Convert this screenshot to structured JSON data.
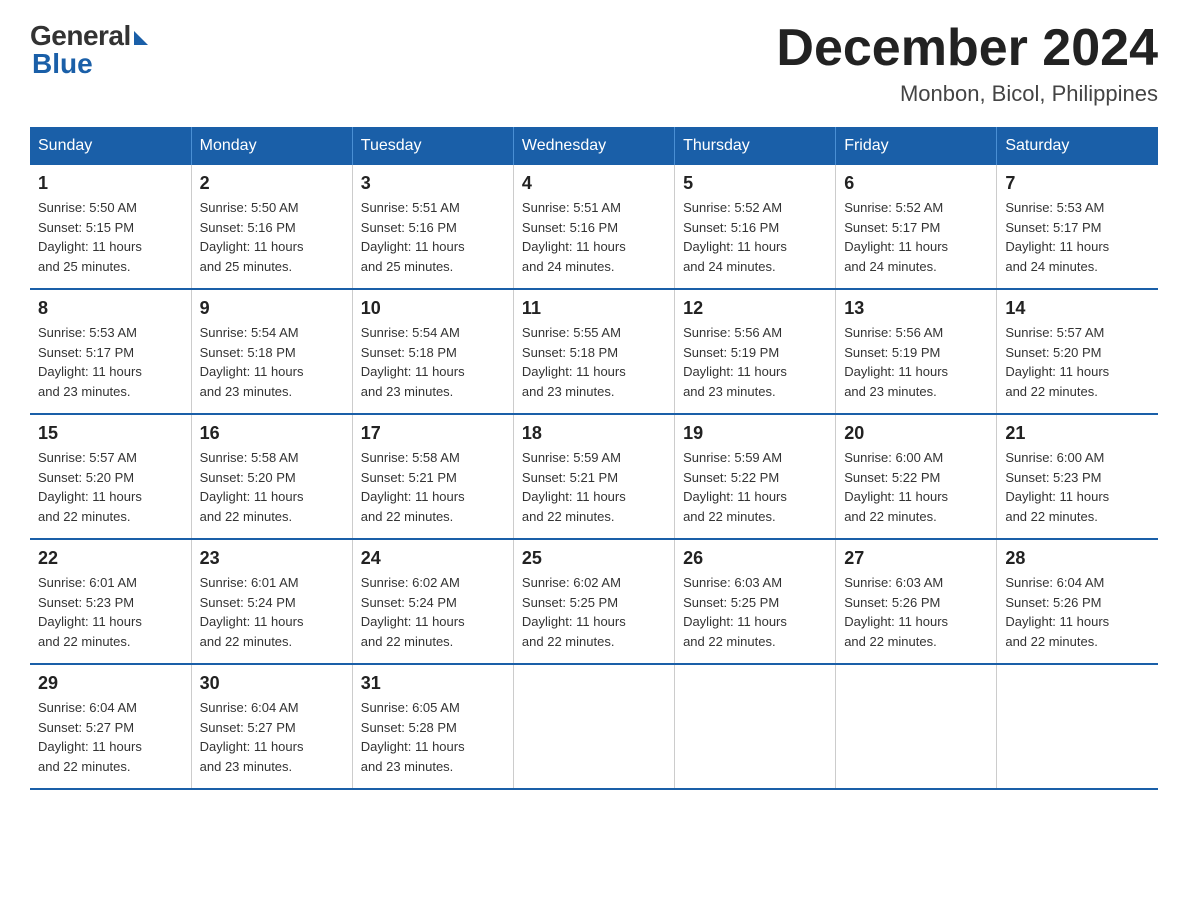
{
  "logo": {
    "general": "General",
    "blue": "Blue"
  },
  "title": {
    "month_year": "December 2024",
    "location": "Monbon, Bicol, Philippines"
  },
  "headers": [
    "Sunday",
    "Monday",
    "Tuesday",
    "Wednesday",
    "Thursday",
    "Friday",
    "Saturday"
  ],
  "weeks": [
    [
      {
        "day": "1",
        "sunrise": "5:50 AM",
        "sunset": "5:15 PM",
        "daylight": "11 hours and 25 minutes."
      },
      {
        "day": "2",
        "sunrise": "5:50 AM",
        "sunset": "5:16 PM",
        "daylight": "11 hours and 25 minutes."
      },
      {
        "day": "3",
        "sunrise": "5:51 AM",
        "sunset": "5:16 PM",
        "daylight": "11 hours and 25 minutes."
      },
      {
        "day": "4",
        "sunrise": "5:51 AM",
        "sunset": "5:16 PM",
        "daylight": "11 hours and 24 minutes."
      },
      {
        "day": "5",
        "sunrise": "5:52 AM",
        "sunset": "5:16 PM",
        "daylight": "11 hours and 24 minutes."
      },
      {
        "day": "6",
        "sunrise": "5:52 AM",
        "sunset": "5:17 PM",
        "daylight": "11 hours and 24 minutes."
      },
      {
        "day": "7",
        "sunrise": "5:53 AM",
        "sunset": "5:17 PM",
        "daylight": "11 hours and 24 minutes."
      }
    ],
    [
      {
        "day": "8",
        "sunrise": "5:53 AM",
        "sunset": "5:17 PM",
        "daylight": "11 hours and 23 minutes."
      },
      {
        "day": "9",
        "sunrise": "5:54 AM",
        "sunset": "5:18 PM",
        "daylight": "11 hours and 23 minutes."
      },
      {
        "day": "10",
        "sunrise": "5:54 AM",
        "sunset": "5:18 PM",
        "daylight": "11 hours and 23 minutes."
      },
      {
        "day": "11",
        "sunrise": "5:55 AM",
        "sunset": "5:18 PM",
        "daylight": "11 hours and 23 minutes."
      },
      {
        "day": "12",
        "sunrise": "5:56 AM",
        "sunset": "5:19 PM",
        "daylight": "11 hours and 23 minutes."
      },
      {
        "day": "13",
        "sunrise": "5:56 AM",
        "sunset": "5:19 PM",
        "daylight": "11 hours and 23 minutes."
      },
      {
        "day": "14",
        "sunrise": "5:57 AM",
        "sunset": "5:20 PM",
        "daylight": "11 hours and 22 minutes."
      }
    ],
    [
      {
        "day": "15",
        "sunrise": "5:57 AM",
        "sunset": "5:20 PM",
        "daylight": "11 hours and 22 minutes."
      },
      {
        "day": "16",
        "sunrise": "5:58 AM",
        "sunset": "5:20 PM",
        "daylight": "11 hours and 22 minutes."
      },
      {
        "day": "17",
        "sunrise": "5:58 AM",
        "sunset": "5:21 PM",
        "daylight": "11 hours and 22 minutes."
      },
      {
        "day": "18",
        "sunrise": "5:59 AM",
        "sunset": "5:21 PM",
        "daylight": "11 hours and 22 minutes."
      },
      {
        "day": "19",
        "sunrise": "5:59 AM",
        "sunset": "5:22 PM",
        "daylight": "11 hours and 22 minutes."
      },
      {
        "day": "20",
        "sunrise": "6:00 AM",
        "sunset": "5:22 PM",
        "daylight": "11 hours and 22 minutes."
      },
      {
        "day": "21",
        "sunrise": "6:00 AM",
        "sunset": "5:23 PM",
        "daylight": "11 hours and 22 minutes."
      }
    ],
    [
      {
        "day": "22",
        "sunrise": "6:01 AM",
        "sunset": "5:23 PM",
        "daylight": "11 hours and 22 minutes."
      },
      {
        "day": "23",
        "sunrise": "6:01 AM",
        "sunset": "5:24 PM",
        "daylight": "11 hours and 22 minutes."
      },
      {
        "day": "24",
        "sunrise": "6:02 AM",
        "sunset": "5:24 PM",
        "daylight": "11 hours and 22 minutes."
      },
      {
        "day": "25",
        "sunrise": "6:02 AM",
        "sunset": "5:25 PM",
        "daylight": "11 hours and 22 minutes."
      },
      {
        "day": "26",
        "sunrise": "6:03 AM",
        "sunset": "5:25 PM",
        "daylight": "11 hours and 22 minutes."
      },
      {
        "day": "27",
        "sunrise": "6:03 AM",
        "sunset": "5:26 PM",
        "daylight": "11 hours and 22 minutes."
      },
      {
        "day": "28",
        "sunrise": "6:04 AM",
        "sunset": "5:26 PM",
        "daylight": "11 hours and 22 minutes."
      }
    ],
    [
      {
        "day": "29",
        "sunrise": "6:04 AM",
        "sunset": "5:27 PM",
        "daylight": "11 hours and 22 minutes."
      },
      {
        "day": "30",
        "sunrise": "6:04 AM",
        "sunset": "5:27 PM",
        "daylight": "11 hours and 23 minutes."
      },
      {
        "day": "31",
        "sunrise": "6:05 AM",
        "sunset": "5:28 PM",
        "daylight": "11 hours and 23 minutes."
      },
      null,
      null,
      null,
      null
    ]
  ],
  "labels": {
    "sunrise": "Sunrise:",
    "sunset": "Sunset:",
    "daylight": "Daylight:"
  }
}
